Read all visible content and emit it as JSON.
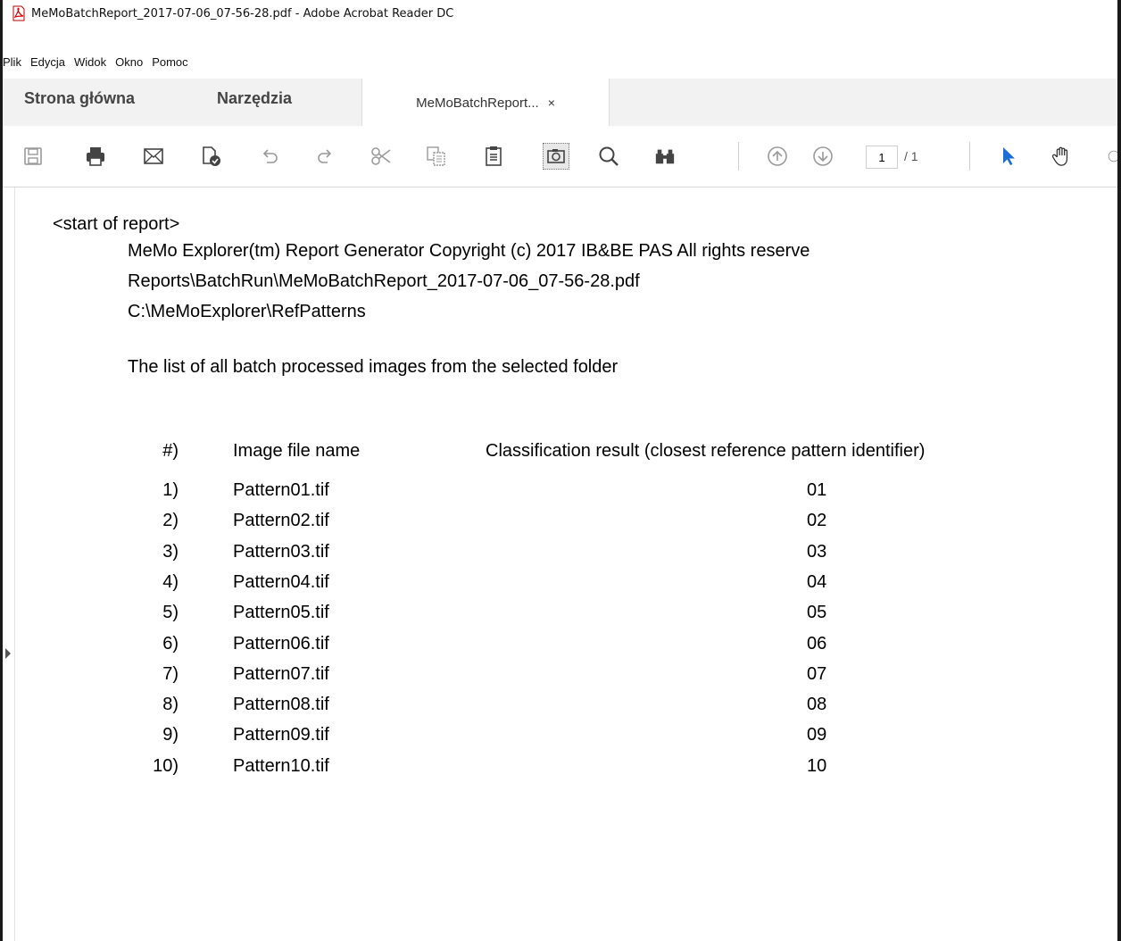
{
  "window": {
    "title": "MeMoBatchReport_2017-07-06_07-56-28.pdf - Adobe Acrobat Reader DC"
  },
  "menu": [
    "Plik",
    "Edycja",
    "Widok",
    "Okno",
    "Pomoc"
  ],
  "tabs": {
    "home": "Strona główna",
    "tools": "Narzędzia",
    "document": "MeMoBatchReport...",
    "close": "×"
  },
  "toolbar": {
    "icons": [
      "save-icon",
      "print-icon",
      "email-icon",
      "certify-icon",
      "undo-icon",
      "redo-icon",
      "cut-icon",
      "copy-icon",
      "paste-icon",
      "snapshot-icon",
      "search-icon",
      "find-icon",
      "page-up-icon",
      "page-down-icon",
      "select-tool-icon",
      "hand-tool-icon"
    ],
    "current_page": "1",
    "total_pages": "/ 1"
  },
  "document": {
    "start_marker": "<start of report>",
    "header_line": "MeMo Explorer(tm) Report Generator   Copyright (c) 2017 IB&BE PAS   All rights reserve",
    "report_path": "Reports\\BatchRun\\MeMoBatchReport_2017-07-06_07-56-28.pdf",
    "ref_path": "C:\\MeMoExplorer\\RefPatterns",
    "list_title": "The list of all batch processed images from the selected folder",
    "columns": {
      "num": "#)",
      "file": "Image file name",
      "result": "Classification result (closest reference pattern identifier)"
    },
    "rows": [
      {
        "num": "1)",
        "file": "Pattern01.tif",
        "result": "01"
      },
      {
        "num": "2)",
        "file": "Pattern02.tif",
        "result": "02"
      },
      {
        "num": "3)",
        "file": "Pattern03.tif",
        "result": "03"
      },
      {
        "num": "4)",
        "file": "Pattern04.tif",
        "result": "04"
      },
      {
        "num": "5)",
        "file": "Pattern05.tif",
        "result": "05"
      },
      {
        "num": "6)",
        "file": "Pattern06.tif",
        "result": "06"
      },
      {
        "num": "7)",
        "file": "Pattern07.tif",
        "result": "07"
      },
      {
        "num": "8)",
        "file": "Pattern08.tif",
        "result": "08"
      },
      {
        "num": "9)",
        "file": "Pattern09.tif",
        "result": "09"
      },
      {
        "num": "10)",
        "file": "Pattern10.tif",
        "result": "10"
      }
    ]
  }
}
